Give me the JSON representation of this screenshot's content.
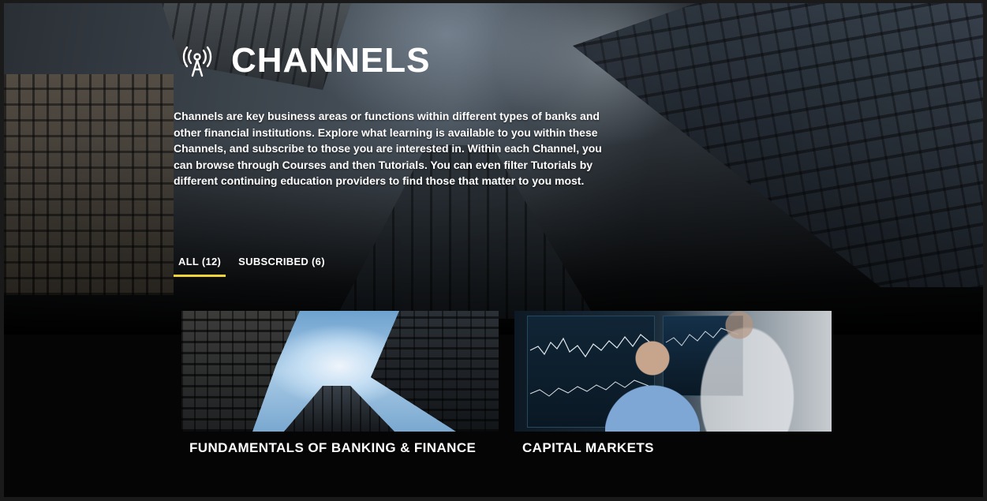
{
  "header": {
    "title": "CHANNELS",
    "icon": "broadcast-icon",
    "intro": "Channels are key business areas or functions within different types of banks and other financial institutions. Explore what learning is available to you within these Channels, and subscribe to those you are interested in. Within each Channel, you can browse through Courses and then Tutorials. You can even filter Tutorials by different continuing education providers to find those that matter to you most."
  },
  "tabs": [
    {
      "label": "ALL (12)",
      "active": true
    },
    {
      "label": "SUBSCRIBED (6)",
      "active": false
    }
  ],
  "cards": [
    {
      "title": "FUNDAMENTALS OF BANKING & FINANCE",
      "image": "skyscrapers-looking-up"
    },
    {
      "title": "CAPITAL MARKETS",
      "image": "traders-at-screens"
    }
  ],
  "colors": {
    "accent": "#f2d43a",
    "background": "#000000",
    "text": "#ffffff"
  }
}
